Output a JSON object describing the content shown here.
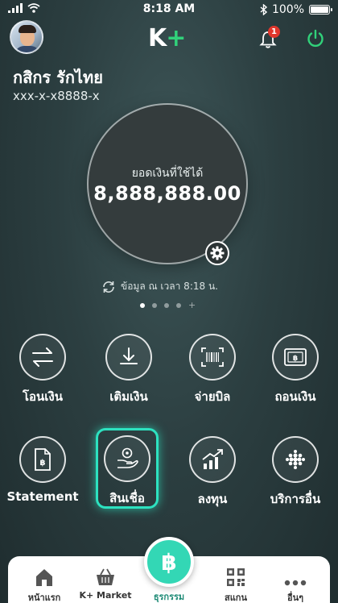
{
  "status_bar": {
    "time": "8:18 AM",
    "battery": "100%",
    "battery_level": 1.0
  },
  "header": {
    "logo_text": "K",
    "logo_plus": "+",
    "notification_count": "1",
    "user_name": "กสิกร รักไทย",
    "account_number": "xxx-x-x8888-x"
  },
  "balance": {
    "label": "ยอดเงินที่ใช้ได้",
    "amount": "8,888,888.00",
    "updated_text": "ข้อมูล ณ เวลา 8:18 น."
  },
  "pager": {
    "pages": 4,
    "active": 0,
    "add_symbol": "+"
  },
  "menu": {
    "transfer": "โอนเงิน",
    "topup": "เติมเงิน",
    "paybill": "จ่ายบิล",
    "withdraw": "ถอนเงิน",
    "statement": "Statement",
    "loan": "สินเชื่อ",
    "invest": "ลงทุน",
    "other_services": "บริการอื่น"
  },
  "bottom_nav": {
    "home": "หน้าแรก",
    "market": "K+ Market",
    "transaction": "ธุรกรรม",
    "scan": "สแกน",
    "more": "อื่นๆ"
  },
  "colors": {
    "accent": "#2de2c0",
    "logo_plus": "#31d17a",
    "badge": "#e0362c",
    "nav_center": "#33d7b5"
  }
}
